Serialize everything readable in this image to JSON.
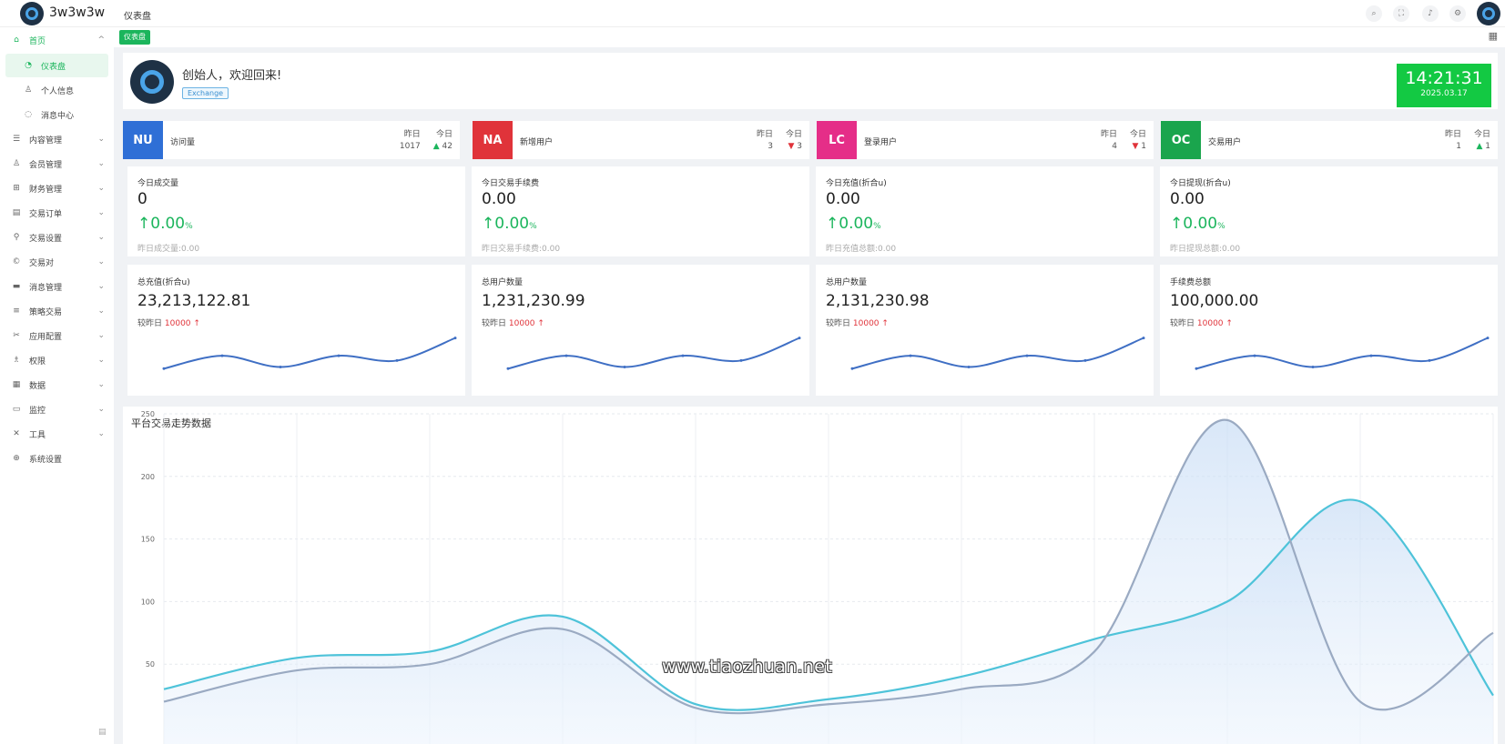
{
  "header": {
    "brand": "3w3w3w",
    "page_title": "仪表盘",
    "icons": [
      "search-icon",
      "fullscreen-icon",
      "bell-icon",
      "settings-icon"
    ]
  },
  "sidebar": {
    "items": [
      {
        "label": "首页",
        "icon": "home-icon",
        "chevron": "^"
      },
      {
        "label": "仪表盘",
        "icon": "dashboard-icon"
      },
      {
        "label": "个人信息",
        "icon": "user-icon"
      },
      {
        "label": "消息中心",
        "icon": "message-icon"
      },
      {
        "label": "内容管理",
        "icon": "list-icon",
        "chevron": "⌄"
      },
      {
        "label": "会员管理",
        "icon": "member-icon",
        "chevron": "⌄"
      },
      {
        "label": "财务管理",
        "icon": "finance-icon",
        "chevron": "⌄"
      },
      {
        "label": "交易订单",
        "icon": "order-icon",
        "chevron": "⌄"
      },
      {
        "label": "交易设置",
        "icon": "wrench-icon",
        "chevron": "⌄"
      },
      {
        "label": "交易对",
        "icon": "pair-icon",
        "chevron": "⌄"
      },
      {
        "label": "消息管理",
        "icon": "mail-icon",
        "chevron": "⌄"
      },
      {
        "label": "策略交易",
        "icon": "strategy-icon",
        "chevron": "⌄"
      },
      {
        "label": "应用配置",
        "icon": "config-icon",
        "chevron": "⌄"
      },
      {
        "label": "权限",
        "icon": "permission-icon",
        "chevron": "⌄"
      },
      {
        "label": "数据",
        "icon": "data-icon",
        "chevron": "⌄"
      },
      {
        "label": "监控",
        "icon": "monitor-icon",
        "chevron": "⌄"
      },
      {
        "label": "工具",
        "icon": "tool-icon",
        "chevron": "⌄"
      },
      {
        "label": "系统设置",
        "icon": "system-icon"
      }
    ]
  },
  "tags": {
    "active": "仪表盘"
  },
  "welcome": {
    "greeting": "创始人，欢迎回来!",
    "badge": "Exchange"
  },
  "clock": {
    "time": "14:21:31",
    "date": "2025.03.17"
  },
  "stats": [
    {
      "abbr": "NU",
      "label": "访问量",
      "color": "#2f6fd6",
      "yesterday_label": "昨日",
      "today_label": "今日",
      "yesterday": "1017",
      "today": "42",
      "trend": "up"
    },
    {
      "abbr": "NA",
      "label": "新增用户",
      "color": "#e0333a",
      "yesterday_label": "昨日",
      "today_label": "今日",
      "yesterday": "3",
      "today": "3",
      "trend": "down"
    },
    {
      "abbr": "LC",
      "label": "登录用户",
      "color": "#e52e88",
      "yesterday_label": "昨日",
      "today_label": "今日",
      "yesterday": "4",
      "today": "1",
      "trend": "down"
    },
    {
      "abbr": "OC",
      "label": "交易用户",
      "color": "#1aa54d",
      "yesterday_label": "昨日",
      "today_label": "今日",
      "yesterday": "1",
      "today": "1",
      "trend": "up"
    }
  ],
  "today_cards": [
    {
      "label": "今日成交量",
      "value": "0",
      "pct": "0.00",
      "unit": "%",
      "yesterday": "昨日成交量:0.00"
    },
    {
      "label": "今日交易手续费",
      "value": "0.00",
      "pct": "0.00",
      "unit": "%",
      "yesterday": "昨日交易手续费:0.00"
    },
    {
      "label": "今日充值(折合u)",
      "value": "0.00",
      "pct": "0.00",
      "unit": "%",
      "yesterday": "昨日充值总额:0.00"
    },
    {
      "label": "今日提现(折合u)",
      "value": "0.00",
      "pct": "0.00",
      "unit": "%",
      "yesterday": "昨日提现总额:0.00"
    }
  ],
  "total_cards": [
    {
      "label": "总充值(折合u)",
      "value": "23,213,122.81",
      "compare_label": "较昨日",
      "compare_value": "10000"
    },
    {
      "label": "总用户数量",
      "value": "1,231,230.99",
      "compare_label": "较昨日",
      "compare_value": "10000"
    },
    {
      "label": "总用户数量",
      "value": "2,131,230.98",
      "compare_label": "较昨日",
      "compare_value": "10000"
    },
    {
      "label": "手续费总额",
      "value": "100,000.00",
      "compare_label": "较昨日",
      "compare_value": "10000"
    }
  ],
  "sparkline_data": {
    "type": "line",
    "values": [
      20,
      36,
      22,
      36,
      30,
      58
    ],
    "color": "#3f6fc4"
  },
  "chart_data": {
    "type": "area",
    "title": "平台交易走势数据",
    "y_ticks": [
      "250",
      "200",
      "150",
      "100",
      "50"
    ],
    "ylim": [
      0,
      250
    ],
    "grid": true,
    "series": [
      {
        "values": [
          30,
          55,
          60,
          88,
          18,
          22,
          40,
          70,
          100,
          180,
          25
        ],
        "color": "#4ec3d9"
      },
      {
        "values": [
          20,
          45,
          50,
          78,
          15,
          18,
          30,
          60,
          245,
          20,
          75
        ],
        "color": "#9aaac2"
      }
    ]
  },
  "watermark": "www.tiaozhuan.net"
}
